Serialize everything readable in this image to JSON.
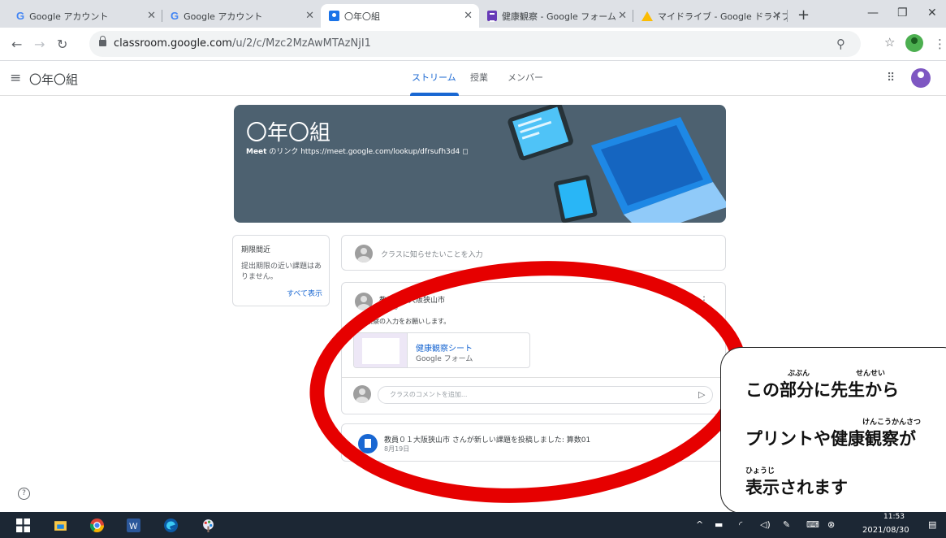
{
  "browser": {
    "tabs": [
      {
        "title": "Google アカウント",
        "icon": "google-g-icon"
      },
      {
        "title": "Google アカウント",
        "icon": "google-g-icon"
      },
      {
        "title": "〇年〇組",
        "icon": "classroom-icon"
      },
      {
        "title": "健康観察 - Google フォーム",
        "icon": "forms-icon"
      },
      {
        "title": "マイドライブ - Google ドライブ",
        "icon": "drive-icon"
      }
    ],
    "url_host": "classroom.google.com",
    "url_path": "/u/2/c/Mzc2MzAwMTAzNjI1"
  },
  "app": {
    "class_name": "〇年〇組",
    "nav_tabs": [
      "ストリーム",
      "授業",
      "メンバー"
    ],
    "active_tab": "ストリーム"
  },
  "banner": {
    "title": "〇年〇組",
    "meet_label": "Meet",
    "meet_text": "のリンク https://meet.google.com/lookup/dfrsufh3d4"
  },
  "upcoming": {
    "title": "期限間近",
    "body": "提出期限の近い課題はありません。",
    "link": "すべて表示"
  },
  "announce_placeholder": "クラスに知らせたいことを入力",
  "post": {
    "author": "教員０１大阪狭山市",
    "time": "11:50",
    "body": "健康観察の入力をお願いします。",
    "attachment_title": "健康観察シート",
    "attachment_type": "Google フォーム",
    "comment_placeholder": "クラスのコメントを追加..."
  },
  "post2": {
    "text": "教員０１大阪狭山市 さんが新しい課題を投稿しました: 算数01",
    "date": "8月19日"
  },
  "callout": {
    "line1": "この部分に先生から",
    "line2": "プリントや健康観察が",
    "line3": "表示されます",
    "ruby_bubun": "ぶぶん",
    "ruby_sensei": "せんせい",
    "ruby_kenkoukansatsu": "けんこうかんさつ",
    "ruby_hyouji": "ひょうじ"
  },
  "taskbar": {
    "time": "11:53",
    "date": "2021/08/30"
  }
}
